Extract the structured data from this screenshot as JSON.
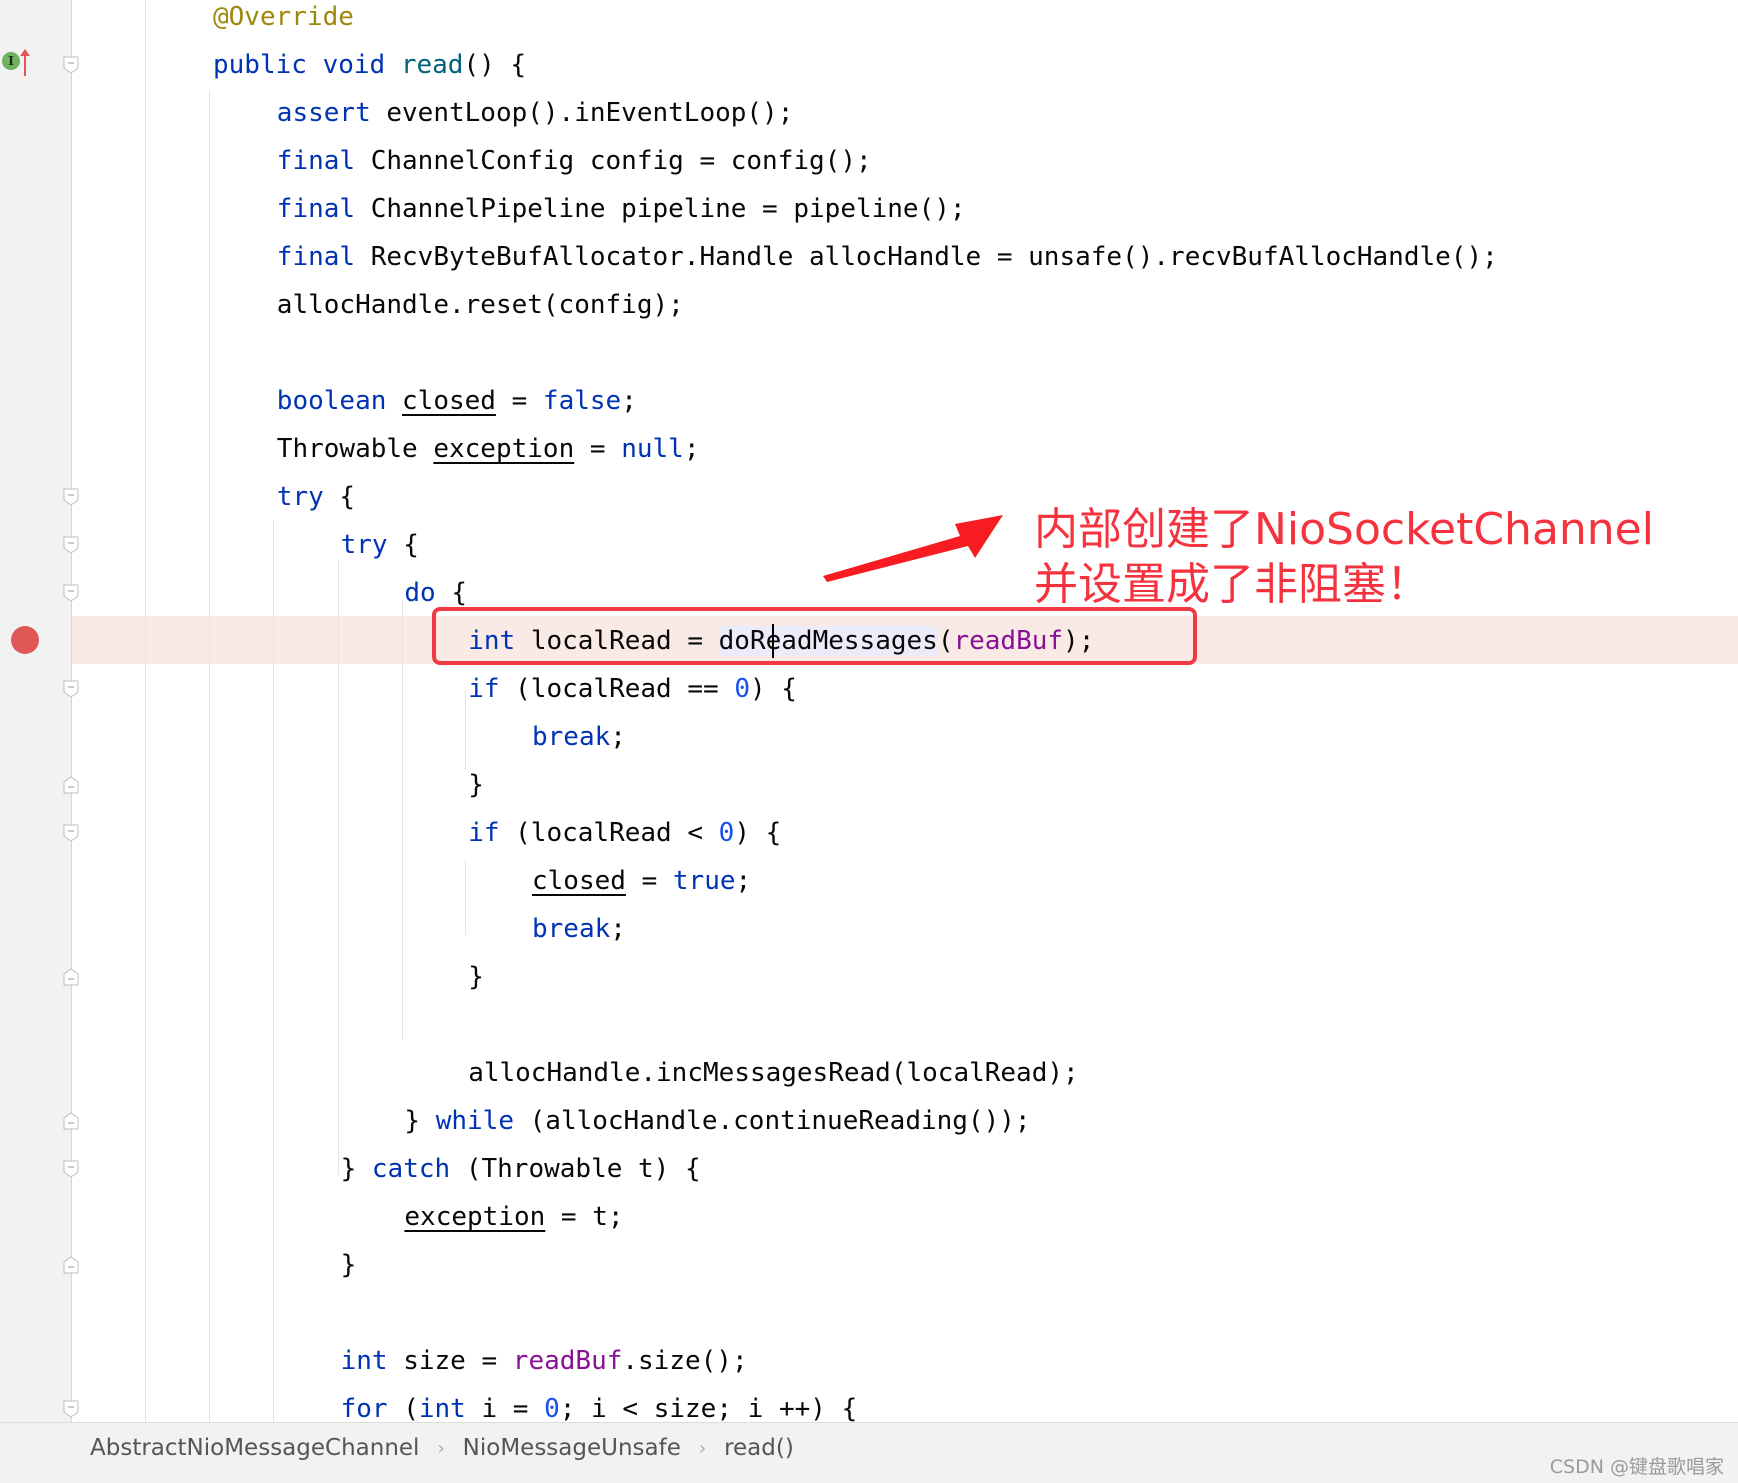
{
  "editor": {
    "lines": [
      {
        "indent": 0,
        "tokens": [
          [
            "ann",
            "@Override"
          ]
        ]
      },
      {
        "indent": 0,
        "tokens": [
          [
            "kw",
            "public void "
          ],
          [
            "mdecl",
            "read"
          ],
          [
            "",
            "() {"
          ]
        ]
      },
      {
        "indent": 1,
        "tokens": [
          [
            "kw",
            "assert "
          ],
          [
            "",
            "eventLoop().inEventLoop();"
          ]
        ]
      },
      {
        "indent": 1,
        "tokens": [
          [
            "kw",
            "final "
          ],
          [
            "",
            "ChannelConfig config = config();"
          ]
        ]
      },
      {
        "indent": 1,
        "tokens": [
          [
            "kw",
            "final "
          ],
          [
            "",
            "ChannelPipeline pipeline = pipeline();"
          ]
        ]
      },
      {
        "indent": 1,
        "tokens": [
          [
            "kw",
            "final "
          ],
          [
            "",
            "RecvByteBufAllocator.Handle allocHandle = unsafe().recvBufAllocHandle();"
          ]
        ]
      },
      {
        "indent": 1,
        "tokens": [
          [
            "",
            "allocHandle.reset(config);"
          ]
        ]
      },
      {
        "indent": 1,
        "tokens": []
      },
      {
        "indent": 1,
        "tokens": [
          [
            "kw",
            "boolean "
          ],
          [
            "var",
            "closed"
          ],
          [
            "",
            " = "
          ],
          [
            "kw",
            "false"
          ],
          [
            "",
            ";"
          ]
        ]
      },
      {
        "indent": 1,
        "tokens": [
          [
            "",
            "Throwable "
          ],
          [
            "var",
            "exception"
          ],
          [
            "",
            " = "
          ],
          [
            "kw",
            "null"
          ],
          [
            "",
            ";"
          ]
        ]
      },
      {
        "indent": 1,
        "tokens": [
          [
            "kw",
            "try"
          ],
          [
            "",
            " {"
          ]
        ]
      },
      {
        "indent": 2,
        "tokens": [
          [
            "kw",
            "try"
          ],
          [
            "",
            " {"
          ]
        ]
      },
      {
        "indent": 3,
        "tokens": [
          [
            "kw",
            "do"
          ],
          [
            "",
            " {"
          ]
        ]
      },
      {
        "indent": 4,
        "tokens": [
          [
            "kw",
            "int "
          ],
          [
            "",
            "localRead = "
          ],
          [
            "hl",
            "doReadMessages"
          ],
          [
            "",
            "("
          ],
          [
            "fld",
            "readBuf"
          ],
          [
            "",
            ");"
          ]
        ]
      },
      {
        "indent": 4,
        "tokens": [
          [
            "kw",
            "if"
          ],
          [
            "",
            " (localRead == "
          ],
          [
            "num",
            "0"
          ],
          [
            "",
            ") {"
          ]
        ]
      },
      {
        "indent": 5,
        "tokens": [
          [
            "kw",
            "break"
          ],
          [
            "",
            ";"
          ]
        ]
      },
      {
        "indent": 4,
        "tokens": [
          [
            "",
            "}"
          ]
        ]
      },
      {
        "indent": 4,
        "tokens": [
          [
            "kw",
            "if"
          ],
          [
            "",
            " (localRead < "
          ],
          [
            "num",
            "0"
          ],
          [
            "",
            ") {"
          ]
        ]
      },
      {
        "indent": 5,
        "tokens": [
          [
            "var",
            "closed"
          ],
          [
            "",
            " = "
          ],
          [
            "kw",
            "true"
          ],
          [
            "",
            ";"
          ]
        ]
      },
      {
        "indent": 5,
        "tokens": [
          [
            "kw",
            "break"
          ],
          [
            "",
            ";"
          ]
        ]
      },
      {
        "indent": 4,
        "tokens": [
          [
            "",
            "}"
          ]
        ]
      },
      {
        "indent": 4,
        "tokens": []
      },
      {
        "indent": 4,
        "tokens": [
          [
            "",
            "allocHandle.incMessagesRead(localRead);"
          ]
        ]
      },
      {
        "indent": 3,
        "tokens": [
          [
            "",
            "} "
          ],
          [
            "kw",
            "while"
          ],
          [
            "",
            " (allocHandle.continueReading());"
          ]
        ]
      },
      {
        "indent": 2,
        "tokens": [
          [
            "",
            "} "
          ],
          [
            "kw",
            "catch"
          ],
          [
            "",
            " (Throwable t) {"
          ]
        ]
      },
      {
        "indent": 3,
        "tokens": [
          [
            "var",
            "exception"
          ],
          [
            "",
            " = t;"
          ]
        ]
      },
      {
        "indent": 2,
        "tokens": [
          [
            "",
            "}"
          ]
        ]
      },
      {
        "indent": 2,
        "tokens": []
      },
      {
        "indent": 2,
        "tokens": [
          [
            "kw",
            "int "
          ],
          [
            "",
            "size = "
          ],
          [
            "fld",
            "readBuf"
          ],
          [
            "",
            ".size();"
          ]
        ]
      },
      {
        "indent": 2,
        "tokens": [
          [
            "kw",
            "for"
          ],
          [
            "",
            " ("
          ],
          [
            "kw",
            "int "
          ],
          [
            "var",
            "i"
          ],
          [
            "",
            " = "
          ],
          [
            "num",
            "0"
          ],
          [
            "",
            "; "
          ],
          [
            "var",
            "i"
          ],
          [
            "",
            " < size; "
          ],
          [
            "var",
            "i"
          ],
          [
            "",
            " ++) {"
          ]
        ]
      }
    ],
    "breakpoint_line": 14,
    "fold_markers": [
      {
        "line": 1,
        "kind": "open"
      },
      {
        "line": 10,
        "kind": "open"
      },
      {
        "line": 11,
        "kind": "open"
      },
      {
        "line": 12,
        "kind": "open"
      },
      {
        "line": 14,
        "kind": "open"
      },
      {
        "line": 16,
        "kind": "close"
      },
      {
        "line": 17,
        "kind": "open"
      },
      {
        "line": 20,
        "kind": "close"
      },
      {
        "line": 23,
        "kind": "close"
      },
      {
        "line": 24,
        "kind": "open"
      },
      {
        "line": 26,
        "kind": "close"
      },
      {
        "line": 29,
        "kind": "open"
      }
    ],
    "gutter_icons": [
      "implements-method-icon",
      "breakpoint-icon"
    ]
  },
  "annotation": {
    "line1": "内部创建了NioSocketChannel",
    "line2": "并设置成了非阻塞！",
    "color": "#f5333f"
  },
  "breadcrumb": [
    "AbstractNioMessageChannel",
    "NioMessageUnsafe",
    "read()"
  ],
  "watermark": "CSDN @键盘歌唱家",
  "colors": {
    "keyword": "#0033b3",
    "annotation": "#9e880d",
    "method": "#00627a",
    "field": "#871094",
    "number": "#1750eb",
    "breakpoint": "#e05757"
  }
}
